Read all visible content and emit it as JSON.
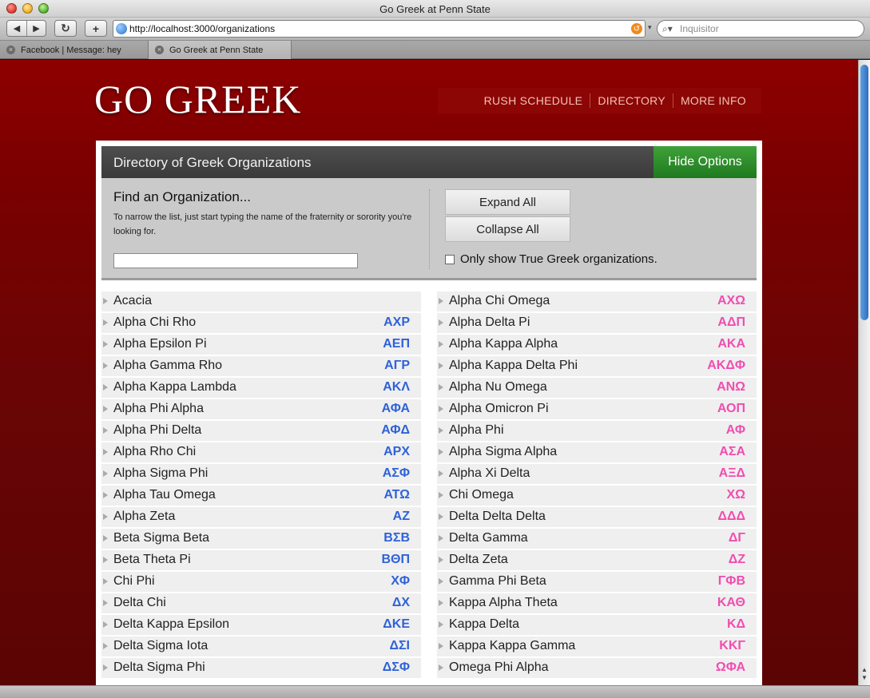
{
  "browser": {
    "window_title": "Go Greek at Penn State",
    "url": "http://localhost:3000/organizations",
    "search_placeholder": "Inquisitor",
    "tabs": [
      {
        "label": "Facebook | Message: hey"
      },
      {
        "label": "Go Greek at Penn State"
      }
    ]
  },
  "site": {
    "logo": "GO GREEK",
    "nav": [
      "RUSH SCHEDULE",
      "DIRECTORY",
      "MORE INFO"
    ]
  },
  "directory": {
    "title": "Directory of Greek Organizations",
    "hide_options_label": "Hide Options",
    "find_title": "Find an Organization...",
    "find_help": "To narrow the list, just start typing the name of the fraternity or sorority you're looking for.",
    "search_value": "",
    "expand_all_label": "Expand All",
    "collapse_all_label": "Collapse All",
    "true_greek_label": "Only show True Greek organizations.",
    "true_greek_checked": false
  },
  "fraternities": [
    {
      "name": "Acacia",
      "letters": ""
    },
    {
      "name": "Alpha Chi Rho",
      "letters": "ΑΧΡ"
    },
    {
      "name": "Alpha Epsilon Pi",
      "letters": "ΑΕΠ"
    },
    {
      "name": "Alpha Gamma Rho",
      "letters": "ΑΓΡ"
    },
    {
      "name": "Alpha Kappa Lambda",
      "letters": "ΑΚΛ"
    },
    {
      "name": "Alpha Phi Alpha",
      "letters": "ΑΦΑ"
    },
    {
      "name": "Alpha Phi Delta",
      "letters": "ΑΦΔ"
    },
    {
      "name": "Alpha Rho Chi",
      "letters": "ΑΡΧ"
    },
    {
      "name": "Alpha Sigma Phi",
      "letters": "ΑΣΦ"
    },
    {
      "name": "Alpha Tau Omega",
      "letters": "ΑΤΩ"
    },
    {
      "name": "Alpha Zeta",
      "letters": "ΑΖ"
    },
    {
      "name": "Beta Sigma Beta",
      "letters": "ΒΣΒ"
    },
    {
      "name": "Beta Theta Pi",
      "letters": "ΒΘΠ"
    },
    {
      "name": "Chi Phi",
      "letters": "ΧΦ"
    },
    {
      "name": "Delta Chi",
      "letters": "ΔΧ"
    },
    {
      "name": "Delta Kappa Epsilon",
      "letters": "ΔΚΕ"
    },
    {
      "name": "Delta Sigma Iota",
      "letters": "ΔΣΙ"
    },
    {
      "name": "Delta Sigma Phi",
      "letters": "ΔΣΦ"
    }
  ],
  "sororities": [
    {
      "name": "Alpha Chi Omega",
      "letters": "ΑΧΩ"
    },
    {
      "name": "Alpha Delta Pi",
      "letters": "ΑΔΠ"
    },
    {
      "name": "Alpha Kappa Alpha",
      "letters": "ΑΚΑ"
    },
    {
      "name": "Alpha Kappa Delta Phi",
      "letters": "ΑΚΔΦ"
    },
    {
      "name": "Alpha Nu Omega",
      "letters": "ΑΝΩ"
    },
    {
      "name": "Alpha Omicron Pi",
      "letters": "ΑΟΠ"
    },
    {
      "name": "Alpha Phi",
      "letters": "ΑΦ"
    },
    {
      "name": "Alpha Sigma Alpha",
      "letters": "ΑΣΑ"
    },
    {
      "name": "Alpha Xi Delta",
      "letters": "ΑΞΔ"
    },
    {
      "name": "Chi Omega",
      "letters": "ΧΩ"
    },
    {
      "name": "Delta Delta Delta",
      "letters": "ΔΔΔ"
    },
    {
      "name": "Delta Gamma",
      "letters": "ΔΓ"
    },
    {
      "name": "Delta Zeta",
      "letters": "ΔΖ"
    },
    {
      "name": "Gamma Phi Beta",
      "letters": "ΓΦΒ"
    },
    {
      "name": "Kappa Alpha Theta",
      "letters": "ΚΑΘ"
    },
    {
      "name": "Kappa Delta",
      "letters": "ΚΔ"
    },
    {
      "name": "Kappa Kappa Gamma",
      "letters": "ΚΚΓ"
    },
    {
      "name": "Omega Phi Alpha",
      "letters": "ΩΦΑ"
    }
  ],
  "colors": {
    "fraternity_letters": "#2f62d8",
    "sorority_letters": "#f04db0",
    "hide_button": "#2a8a28",
    "page_background": "#7a0000"
  }
}
